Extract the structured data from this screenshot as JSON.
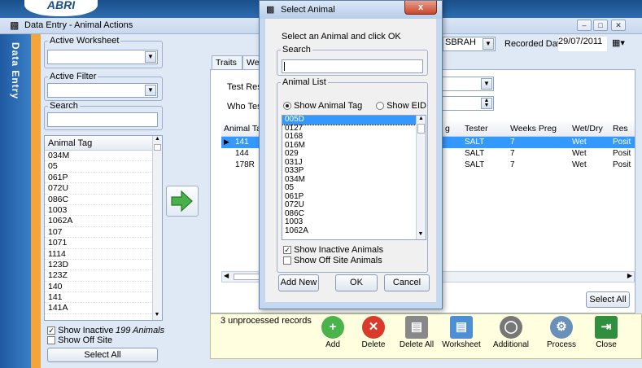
{
  "app": {
    "logo": "ABRI",
    "window_title": "Data Entry - Animal Actions",
    "side_label": "Data Entry"
  },
  "left": {
    "active_worksheet_label": "Active Worksheet",
    "active_worksheet_value": "",
    "active_filter_label": "Active Filter",
    "active_filter_value": "",
    "search_label": "Search",
    "search_value": "",
    "list_header": "Animal Tag",
    "sort_glyph": "⁄",
    "animals": [
      "034M",
      "05",
      "061P",
      "072U",
      "086C",
      "1003",
      "1062A",
      "107",
      "1071",
      "1114",
      "123D",
      "123Z",
      "140",
      "141",
      "141A"
    ],
    "show_inactive_label": "Show Inactive",
    "show_inactive_checked": true,
    "animal_count": "199 Animals",
    "show_offsite_label": "Show Off Site",
    "show_offsite_checked": false,
    "select_all_label": "Select All"
  },
  "main": {
    "tab_traits": "Traits",
    "tab_weights": "Weig",
    "test_result_label": "Test Resul",
    "who_tested_label": "Who Teste",
    "tester_value": "SBRAH",
    "recorded_date_label": "Recorded Date",
    "recorded_date_value": "29/07/2011",
    "grid_columns": [
      "Animal Tag",
      "g",
      "Tester",
      "Weeks Preg",
      "Wet/Dry",
      "Res"
    ],
    "grid_rows": [
      {
        "tag": "141",
        "tester": "SALT",
        "weeks": "7",
        "wetdry": "Wet",
        "res": "Posit",
        "selected": true
      },
      {
        "tag": "144",
        "tester": "SALT",
        "weeks": "7",
        "wetdry": "Wet",
        "res": "Posit",
        "selected": false
      },
      {
        "tag": "178R",
        "tester": "SALT",
        "weeks": "7",
        "wetdry": "Wet",
        "res": "Posit",
        "selected": false
      }
    ],
    "select_all_label": "Select All",
    "unprocessed": "3 unprocessed records"
  },
  "toolbar": {
    "add": "Add",
    "delete": "Delete",
    "delete_all": "Delete All",
    "worksheet": "Worksheet",
    "additional": "Additional",
    "process": "Process",
    "close": "Close"
  },
  "dialog": {
    "title": "Select Animal",
    "close_glyph": "x",
    "instruction": "Select an Animal and click OK",
    "search_label": "Search",
    "search_value": "",
    "list_label": "Animal List",
    "show_tag_label": "Show Animal Tag",
    "show_eid_label": "Show EID",
    "animals": [
      "005D",
      "0127",
      "0168",
      "016M",
      "029",
      "031J",
      "033P",
      "034M",
      "05",
      "061P",
      "072U",
      "086C",
      "1003",
      "1062A"
    ],
    "show_inactive_label": "Show Inactive Animals",
    "show_inactive_checked": true,
    "show_offsite_label": "Show Off Site Animals",
    "show_offsite_checked": false,
    "add_new_label": "Add New",
    "ok_label": "OK",
    "cancel_label": "Cancel"
  },
  "colors": {
    "accent": "#3399ff",
    "side_blue": "#1f5aa0",
    "orange": "#f3a43a",
    "toolbar_bg": "#ffffe0"
  }
}
